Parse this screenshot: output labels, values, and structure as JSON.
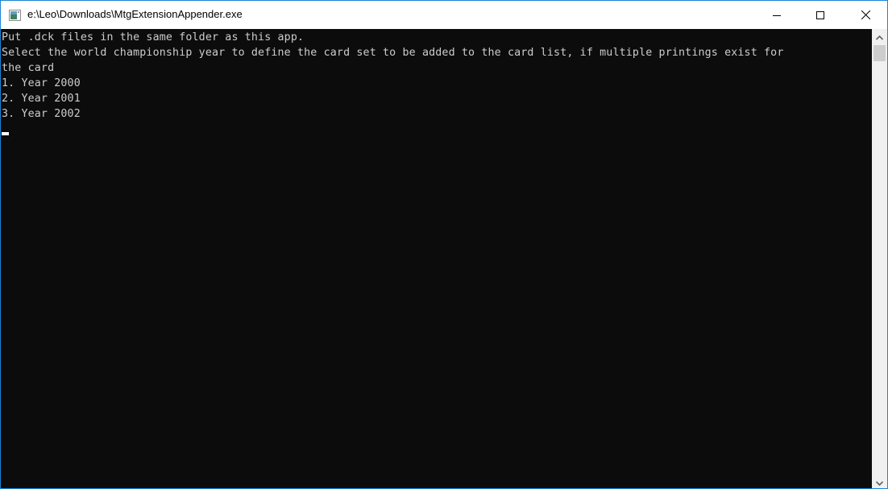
{
  "window": {
    "title": "e:\\Leo\\Downloads\\MtgExtensionAppender.exe",
    "icon": "console-app-icon",
    "controls": {
      "minimize": "minimize-icon",
      "maximize": "maximize-icon",
      "close": "close-icon"
    }
  },
  "console": {
    "lines": [
      "Put .dck files in the same folder as this app.",
      "Select the world championship year to define the card set to be added to the card list, if multiple printings exist for",
      "the card",
      "1. Year 2000",
      "2. Year 2001",
      "3. Year 2002"
    ],
    "colors": {
      "background": "#0c0c0c",
      "text": "#cccccc"
    }
  },
  "scrollbar": {
    "position_fraction": 0.0
  }
}
